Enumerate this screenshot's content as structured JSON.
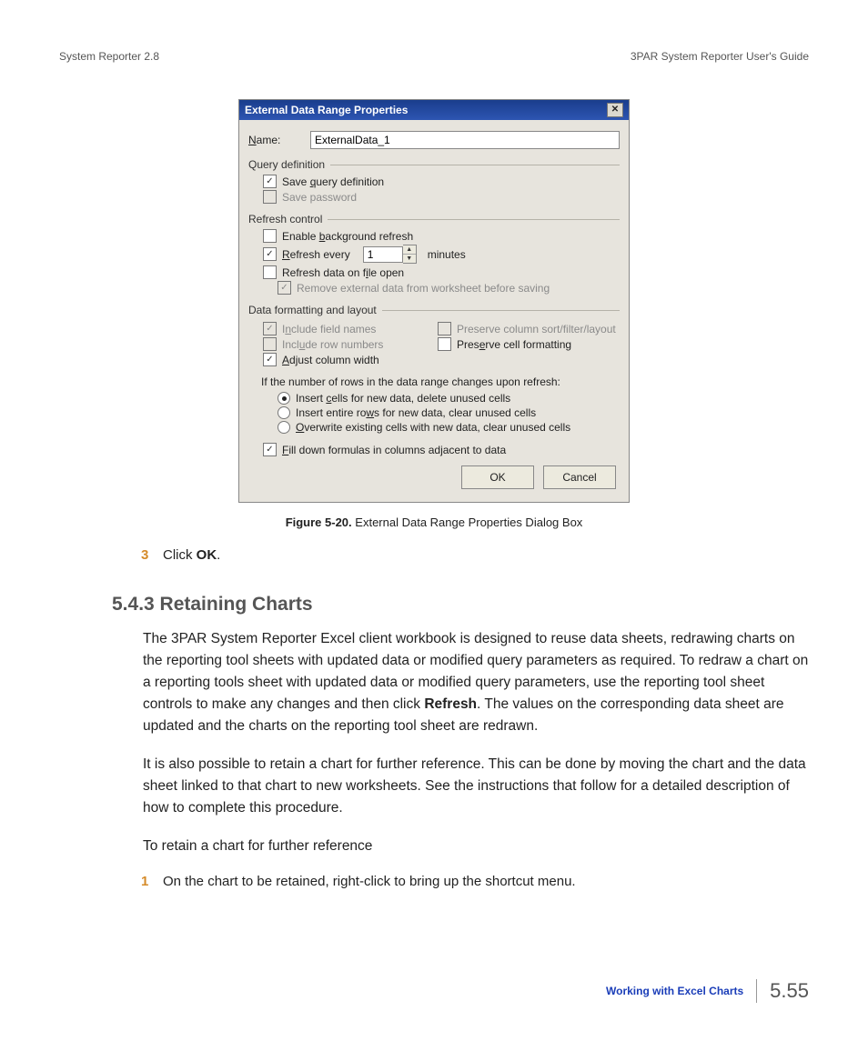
{
  "header": {
    "left": "System Reporter 2.8",
    "right": "3PAR System Reporter User's Guide"
  },
  "dialog": {
    "title": "External Data Range Properties",
    "name": {
      "label": "Name:",
      "value": "ExternalData_1"
    },
    "groups": {
      "query": {
        "title": "Query definition",
        "save_query": {
          "label": "Save query definition",
          "checked": true,
          "underline": "q"
        },
        "save_password": {
          "label": "Save password",
          "checked": false,
          "disabled": true
        }
      },
      "refresh": {
        "title": "Refresh control",
        "bg": {
          "label": "Enable background refresh",
          "checked": false,
          "underline": "b"
        },
        "every": {
          "label": "Refresh every",
          "checked": true,
          "value": "1",
          "suffix": "minutes",
          "underline": "R"
        },
        "on_open": {
          "label": "Refresh data on file open",
          "checked": false,
          "underline": "i"
        },
        "remove": {
          "label": "Remove external data from worksheet before saving",
          "checked": true,
          "disabled": true
        }
      },
      "format": {
        "title": "Data formatting and layout",
        "include_fields": {
          "label": "Include field names",
          "checked": true,
          "disabled": true,
          "underline": "n"
        },
        "include_rownums": {
          "label": "Include row numbers",
          "checked": false,
          "disabled": true,
          "underline": "u"
        },
        "adjust_width": {
          "label": "Adjust column width",
          "checked": true,
          "underline": "A"
        },
        "preserve_sort": {
          "label": "Preserve column sort/filter/layout",
          "checked": false,
          "disabled": true
        },
        "preserve_fmt": {
          "label": "Preserve cell formatting",
          "checked": false,
          "underline": "e"
        }
      },
      "rows": {
        "intro": "If the number of rows in the data range changes upon refresh:",
        "r1": {
          "label": "Insert cells for new data, delete unused cells",
          "selected": true,
          "underline": "c"
        },
        "r2": {
          "label": "Insert entire rows for new data, clear unused cells",
          "selected": false,
          "underline": "w"
        },
        "r3": {
          "label": "Overwrite existing cells with new data, clear unused cells",
          "selected": false,
          "underline": "O"
        },
        "fill": {
          "label": "Fill down formulas in columns adjacent to data",
          "checked": true,
          "underline": "F"
        }
      }
    },
    "buttons": {
      "ok": "OK",
      "cancel": "Cancel"
    }
  },
  "figure": {
    "label": "Figure 5-20.",
    "caption": "External Data Range Properties Dialog Box"
  },
  "steps": {
    "s3": {
      "num": "3",
      "pre": "Click ",
      "bold": "OK",
      "post": "."
    },
    "s1": {
      "num": "1",
      "text": "On the chart to be retained, right-click to bring up the shortcut menu."
    }
  },
  "section": {
    "heading": "5.4.3 Retaining Charts"
  },
  "para1": {
    "t1": "The 3PAR System Reporter Excel client workbook is designed to reuse data sheets, redrawing charts on the reporting tool sheets with updated data or modified query parameters as required. To redraw a chart on a reporting tools sheet with updated data or modified query parameters, use the reporting tool sheet controls to make any changes and then click ",
    "bold": "Refresh",
    "t2": ". The values on the corresponding data sheet are updated and the charts on the reporting tool sheet are redrawn."
  },
  "para2": "It is also possible to retain a chart for further reference. This can be done by moving the chart and the data sheet linked to that chart to new worksheets. See the instructions that follow for a detailed description of how to complete this procedure.",
  "para3": "To retain a chart for further reference",
  "footer": {
    "link": "Working with Excel Charts",
    "page": "5.55"
  }
}
